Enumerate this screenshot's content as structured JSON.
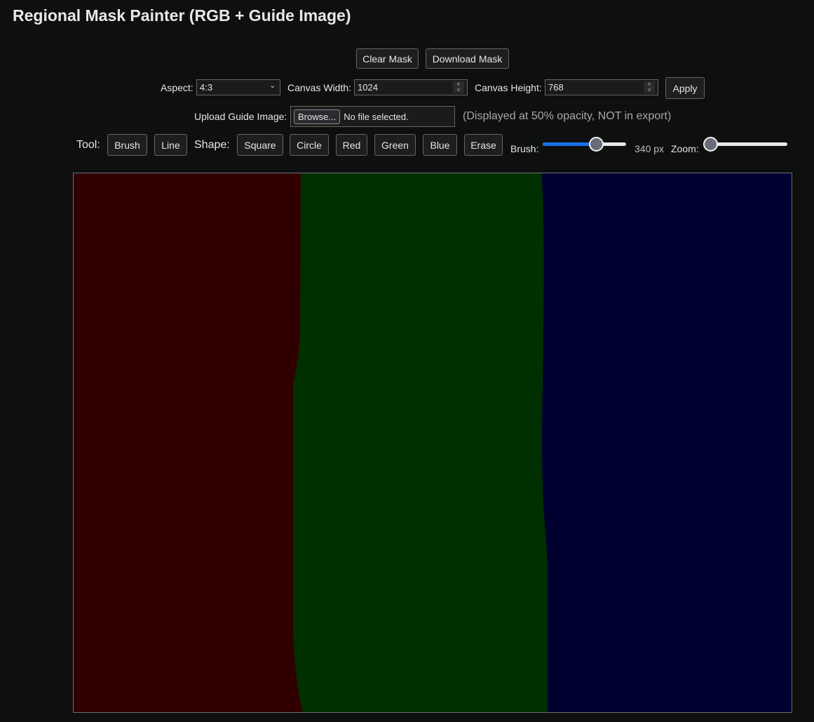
{
  "title": "Regional Mask Painter (RGB + Guide Image)",
  "actions": {
    "clear": "Clear Mask",
    "download": "Download Mask"
  },
  "settings": {
    "aspect_label": "Aspect:",
    "aspect_value": "4:3",
    "width_label": "Canvas Width:",
    "width_value": "1024",
    "height_label": "Canvas Height:",
    "height_value": "768",
    "apply": "Apply"
  },
  "upload": {
    "label": "Upload Guide Image:",
    "browse": "Browse...",
    "status": "No file selected.",
    "note": "(Displayed at 50% opacity, NOT in export)"
  },
  "tools": {
    "tool_label": "Tool:",
    "brush": "Brush",
    "line": "Line",
    "shape_label": "Shape:",
    "square": "Square",
    "circle": "Circle",
    "red": "Red",
    "green": "Green",
    "blue": "Blue",
    "erase": "Erase",
    "brush_label": "Brush:",
    "brush_value_text": "340 px",
    "brush_fraction": 0.64,
    "zoom_label": "Zoom:",
    "zoom_fraction": 0.08
  },
  "canvas": {
    "colors": {
      "red": "#300000",
      "green": "#003000",
      "blue": "#000030"
    }
  }
}
